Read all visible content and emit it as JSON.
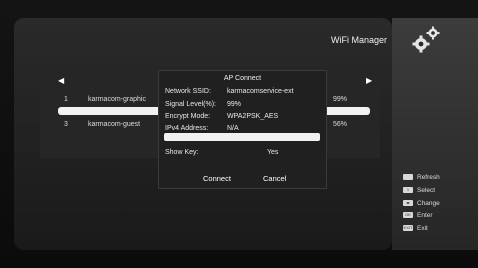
{
  "header": {
    "title": "WiFi Manager",
    "icon": "gear-icon"
  },
  "networks": [
    {
      "index": "1",
      "ssid": "karmacom-graphic",
      "signal": "99%"
    },
    {
      "index": "3",
      "ssid": "karmacom-guest",
      "signal": "56%"
    }
  ],
  "dialog": {
    "title": "AP Connect",
    "fields": [
      {
        "label": "Network SSID:",
        "value": "karmacomservice-ext"
      },
      {
        "label": "Signal Level(%):",
        "value": "99%"
      },
      {
        "label": "Encrypt Mode:",
        "value": "WPA2PSK_AES"
      },
      {
        "label": "IPv4 Address:",
        "value": "N/A"
      }
    ],
    "show_key_label": "Show Key:",
    "show_key_value": "Yes",
    "connect_label": "Connect",
    "cancel_label": "Cancel"
  },
  "legend": [
    {
      "key": "",
      "label": "Refresh",
      "icon": "red-button-icon"
    },
    {
      "key": "1",
      "label": "Select",
      "icon": "select-key-icon"
    },
    {
      "key": "◂▸",
      "label": "Change",
      "icon": "left-right-key-icon"
    },
    {
      "key": "OK",
      "label": "Enter",
      "icon": "ok-key-icon"
    },
    {
      "key": "EXIT",
      "label": "Exit",
      "icon": "exit-key-icon"
    }
  ]
}
